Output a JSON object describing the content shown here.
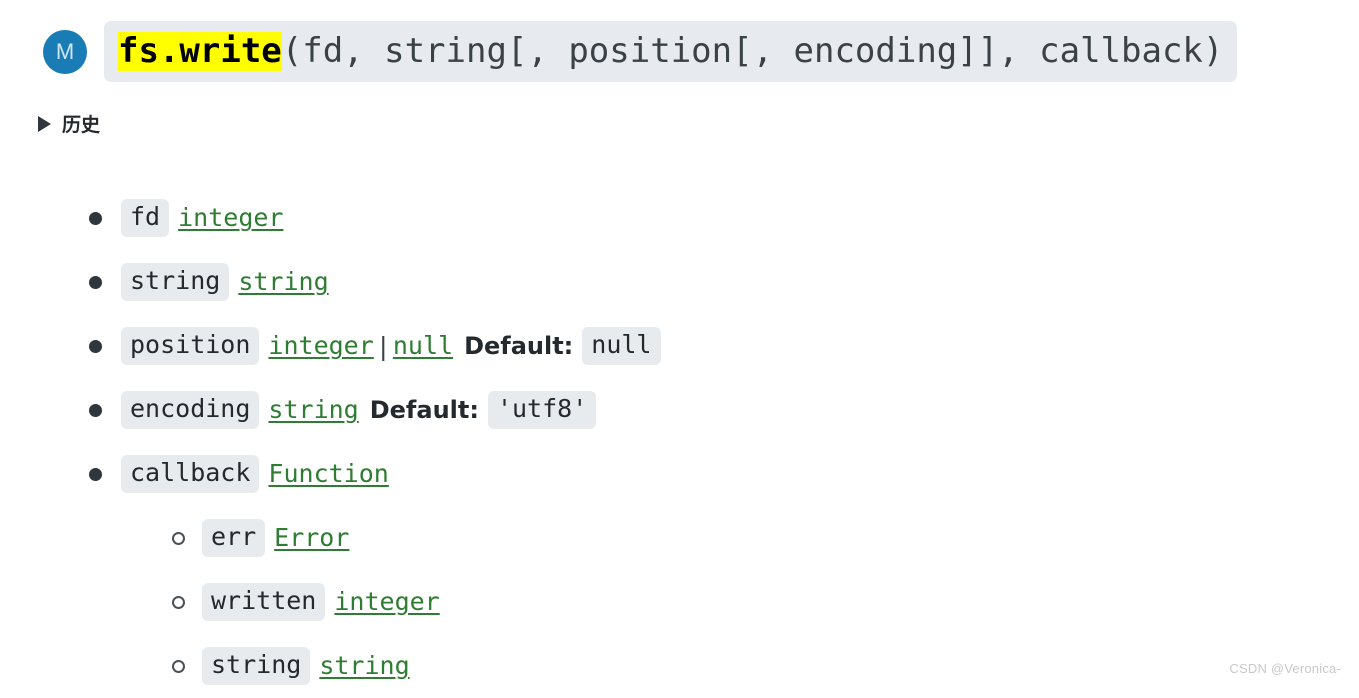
{
  "signature": {
    "badge_letter": "M",
    "badge_color": "#1a7cb5",
    "highlight_color": "#ffff00",
    "highlighted_text": "fs.write",
    "rest_text": "(fd, string[, position[, encoding]], callback)",
    "full_text": "fs.write(fd, string[, position[, encoding]], callback)"
  },
  "history": {
    "label": "历史",
    "expanded": false,
    "marker": "triangle-right-icon"
  },
  "link_color": "#2f7d32",
  "chip_color": "#e8ebed",
  "params": [
    {
      "level": 1,
      "name": "fd",
      "type": "integer",
      "type_link": true,
      "alt_type": null,
      "default_label": null,
      "default_value": null
    },
    {
      "level": 1,
      "name": "string",
      "type": "string",
      "type_link": true,
      "alt_type": null,
      "default_label": null,
      "default_value": null
    },
    {
      "level": 1,
      "name": "position",
      "type": "integer",
      "type_link": true,
      "separator": "|",
      "alt_type": "null",
      "default_label": "Default:",
      "default_value": "null"
    },
    {
      "level": 1,
      "name": "encoding",
      "type": "string",
      "type_link": true,
      "alt_type": null,
      "default_label": "Default:",
      "default_value": "'utf8'"
    },
    {
      "level": 1,
      "name": "callback",
      "type": "Function",
      "type_link": true,
      "alt_type": null,
      "default_label": null,
      "default_value": null
    },
    {
      "level": 2,
      "name": "err",
      "type": "Error",
      "type_link": true,
      "alt_type": null,
      "default_label": null,
      "default_value": null
    },
    {
      "level": 2,
      "name": "written",
      "type": "integer",
      "type_link": true,
      "alt_type": null,
      "default_label": null,
      "default_value": null
    },
    {
      "level": 2,
      "name": "string",
      "type": "string",
      "type_link": true,
      "alt_type": null,
      "default_label": null,
      "default_value": null
    }
  ],
  "watermark": "CSDN @Veronica-"
}
